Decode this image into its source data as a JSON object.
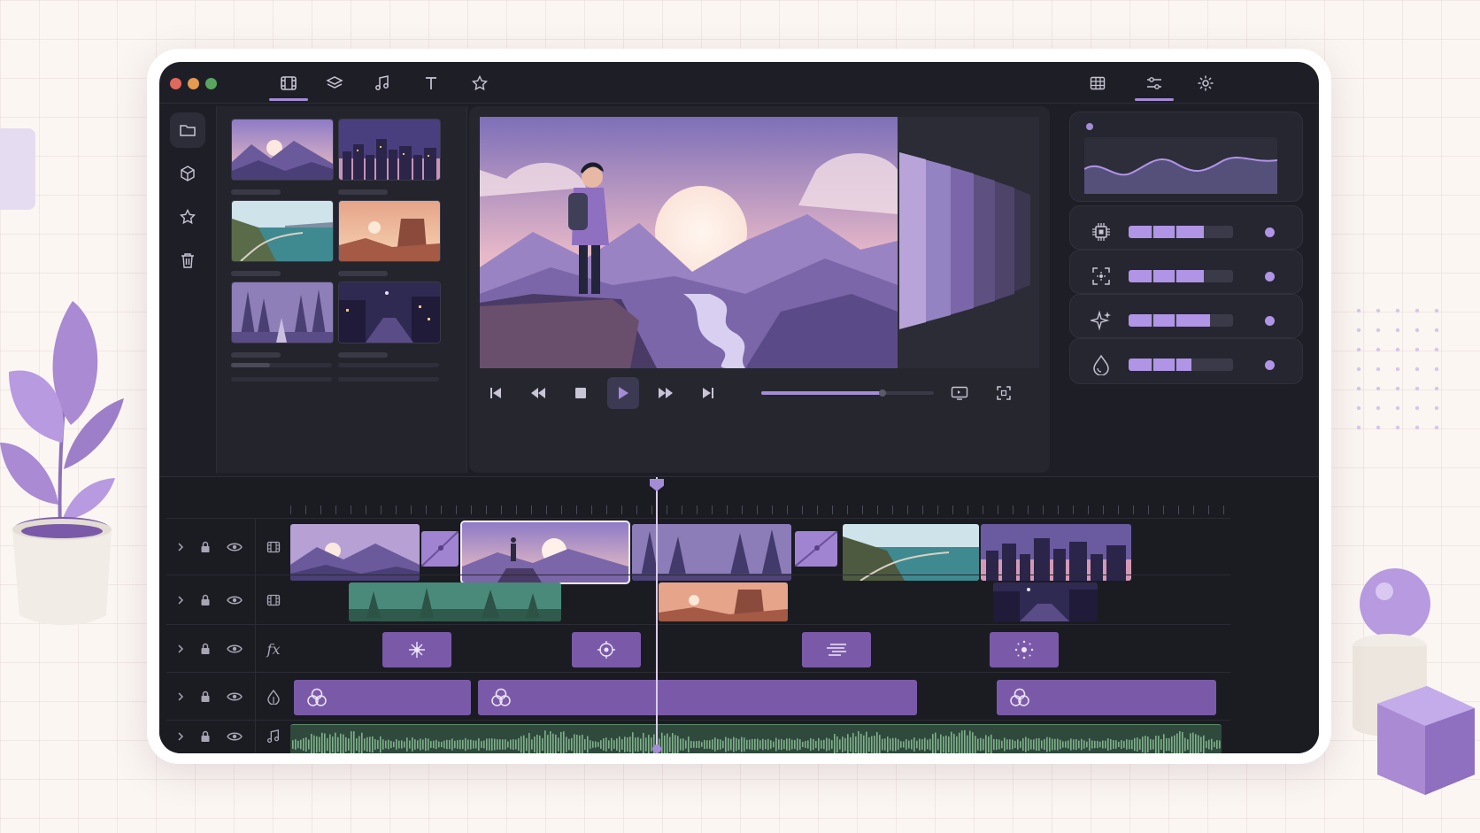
{
  "window": {
    "title": "",
    "traffic_lights": [
      {
        "name": "close",
        "color": "#e0685c"
      },
      {
        "name": "minimize",
        "color": "#e39b52"
      },
      {
        "name": "maximize",
        "color": "#59a45e"
      }
    ]
  },
  "topbar": {
    "left_tabs": [
      {
        "id": "media",
        "icon": "film-icon",
        "active": true
      },
      {
        "id": "layers",
        "icon": "layers-icon",
        "active": false
      },
      {
        "id": "audio",
        "icon": "music-icon",
        "active": false
      },
      {
        "id": "text",
        "icon": "text-icon",
        "active": false
      },
      {
        "id": "favorites",
        "icon": "star-icon",
        "active": false
      }
    ],
    "right_tabs": [
      {
        "id": "grid",
        "icon": "grid-icon",
        "active": false
      },
      {
        "id": "adjust",
        "icon": "sliders-icon",
        "active": true
      },
      {
        "id": "settings",
        "icon": "gear-icon",
        "active": false
      }
    ]
  },
  "sidebar": {
    "items": [
      {
        "icon": "folder-icon",
        "active": true
      },
      {
        "icon": "cube-icon",
        "active": false
      },
      {
        "icon": "star-icon",
        "active": false
      },
      {
        "icon": "trash-icon",
        "active": false
      }
    ]
  },
  "media_browser": {
    "thumbnails": [
      {
        "scene": "mountain-sunset"
      },
      {
        "scene": "night-city"
      },
      {
        "scene": "coastal-road"
      },
      {
        "scene": "desert-mesa"
      },
      {
        "scene": "misty-forest"
      },
      {
        "scene": "night-street"
      }
    ]
  },
  "preview": {
    "scene": "hiker-on-cliff-at-sunset",
    "playback_progress": 0.7,
    "controls": [
      {
        "id": "skip-start",
        "icon": "skip-back-icon"
      },
      {
        "id": "rewind",
        "icon": "rewind-icon"
      },
      {
        "id": "stop",
        "icon": "stop-icon"
      },
      {
        "id": "play",
        "icon": "play-icon"
      },
      {
        "id": "fast-forward",
        "icon": "fast-forward-icon"
      },
      {
        "id": "skip-end",
        "icon": "skip-forward-icon"
      }
    ]
  },
  "adjustments": {
    "waveform_preview": true,
    "sliders": [
      {
        "icon": "chip-icon",
        "level": 0.72
      },
      {
        "icon": "focus-icon",
        "level": 0.72
      },
      {
        "icon": "sparkle-icon",
        "level": 0.78
      },
      {
        "icon": "drop-icon",
        "level": 0.6
      }
    ]
  },
  "timeline": {
    "playhead_position": 0.39,
    "tracks": [
      {
        "type": "video",
        "icon": "film-icon"
      },
      {
        "type": "video",
        "icon": "film-icon"
      },
      {
        "type": "effects",
        "icon": "fx-icon",
        "label": "fx"
      },
      {
        "type": "color",
        "icon": "color-circles-icon"
      },
      {
        "type": "audio",
        "icon": "music-icon"
      }
    ]
  }
}
